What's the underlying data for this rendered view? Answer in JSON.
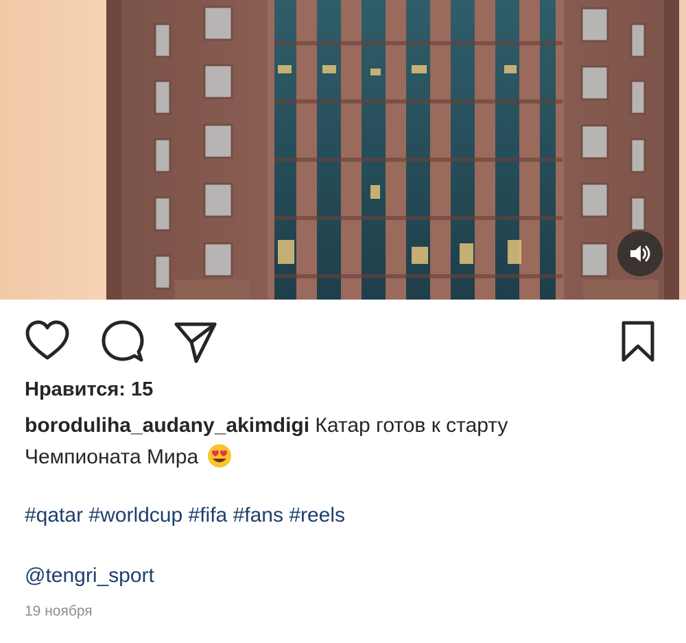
{
  "post": {
    "likes_label": "Нравится: 15",
    "username": "boroduliha_audany_akimdigi",
    "caption_line1": "Катар готов к старту",
    "caption_line2": "Чемпионата Мира",
    "caption_emoji": "heart-eyes-emoji",
    "hashtags": [
      "#qatar",
      "#worldcup",
      "#fifa",
      "#fans",
      "#reels"
    ],
    "mention": "@tengri_sport",
    "date": "19 ноября"
  },
  "icons": {
    "like": "heart-icon",
    "comment": "comment-bubble-icon",
    "share": "paper-plane-icon",
    "save": "bookmark-icon",
    "volume": "speaker-icon"
  },
  "colors": {
    "text": "#262626",
    "link": "#1d3f6e",
    "muted": "#8e8e8e",
    "sky": "#f1c9a6",
    "building": "#8c5f53"
  }
}
